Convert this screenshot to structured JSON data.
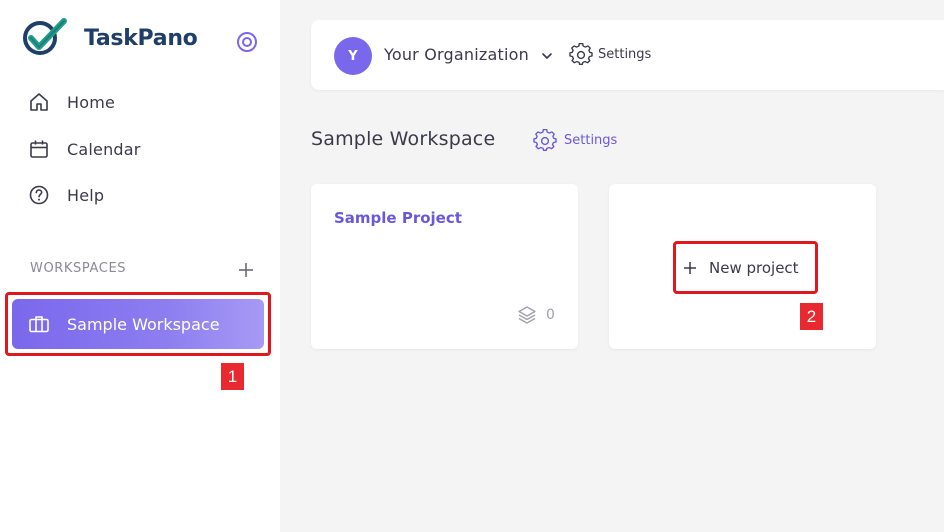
{
  "app": {
    "name": "TaskPano"
  },
  "sidebar": {
    "nav": [
      {
        "label": "Home",
        "icon": "home-icon"
      },
      {
        "label": "Calendar",
        "icon": "calendar-icon"
      },
      {
        "label": "Help",
        "icon": "help-icon"
      }
    ],
    "workspaces_header": "WORKSPACES",
    "workspaces": [
      {
        "label": "Sample Workspace",
        "icon": "briefcase-icon",
        "active": true
      }
    ]
  },
  "topbar": {
    "avatar_initial": "Y",
    "org_name": "Your Organization",
    "settings_label": "Settings"
  },
  "workspace": {
    "title": "Sample Workspace",
    "settings_label": "Settings",
    "projects": [
      {
        "title": "Sample Project",
        "count": "0"
      }
    ],
    "new_project_label": "New project"
  },
  "annotations": {
    "badge_1": "1",
    "badge_2": "2"
  },
  "colors": {
    "accent": "#7a68ec",
    "accent_text": "#6a58dc",
    "highlight": "#e0181e",
    "logo_navy": "#1f3f6a",
    "logo_teal": "#1f9e8a"
  }
}
